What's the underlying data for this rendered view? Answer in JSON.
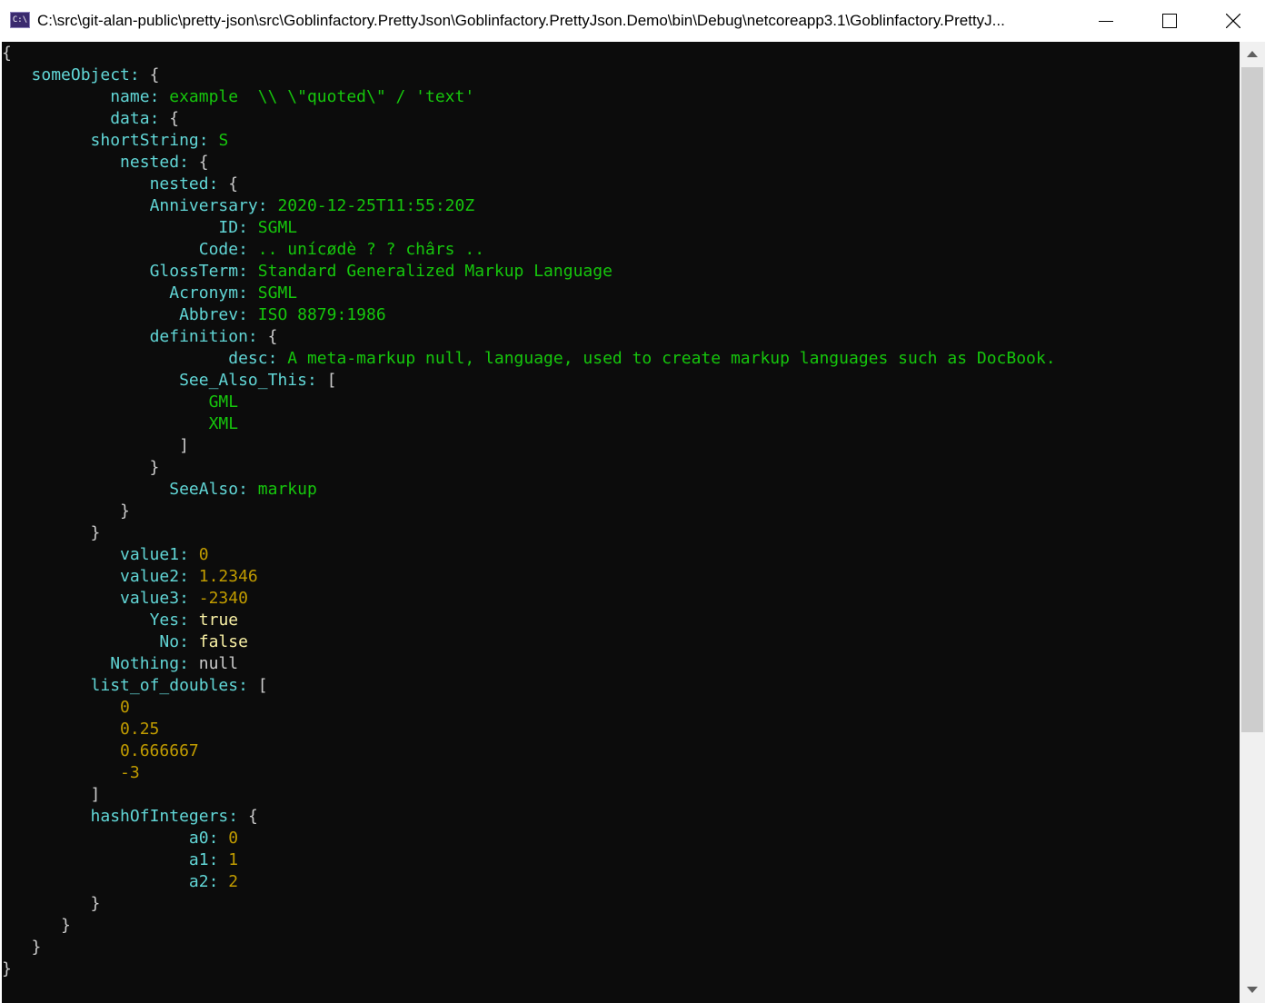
{
  "window": {
    "title": "C:\\src\\git-alan-public\\pretty-json\\src\\Goblinfactory.PrettyJson\\Goblinfactory.PrettyJson.Demo\\bin\\Debug\\netcoreapp3.1\\Goblinfactory.PrettyJ...",
    "icon_label": "C:\\"
  },
  "colors": {
    "key": "#61d6d6",
    "string": "#16c60c",
    "number": "#c19c00",
    "boolean": "#f9f1a5",
    "punctuation": "#cccccc",
    "background": "#0c0c0c"
  },
  "console": {
    "lines": [
      [
        {
          "t": "p",
          "v": "{"
        }
      ],
      [
        {
          "t": "p",
          "v": "   "
        },
        {
          "t": "k",
          "v": "someObject:"
        },
        {
          "t": "p",
          "v": " {"
        }
      ],
      [
        {
          "t": "p",
          "v": "           "
        },
        {
          "t": "k",
          "v": "name:"
        },
        {
          "t": "p",
          "v": " "
        },
        {
          "t": "s",
          "v": "example  \\\\ \\\"quoted\\\" / 'text'"
        }
      ],
      [
        {
          "t": "p",
          "v": "           "
        },
        {
          "t": "k",
          "v": "data:"
        },
        {
          "t": "p",
          "v": " {"
        }
      ],
      [
        {
          "t": "p",
          "v": "         "
        },
        {
          "t": "k",
          "v": "shortString:"
        },
        {
          "t": "p",
          "v": " "
        },
        {
          "t": "s",
          "v": "S"
        }
      ],
      [
        {
          "t": "p",
          "v": "            "
        },
        {
          "t": "k",
          "v": "nested:"
        },
        {
          "t": "p",
          "v": " {"
        }
      ],
      [
        {
          "t": "p",
          "v": "               "
        },
        {
          "t": "k",
          "v": "nested:"
        },
        {
          "t": "p",
          "v": " {"
        }
      ],
      [
        {
          "t": "p",
          "v": "               "
        },
        {
          "t": "k",
          "v": "Anniversary:"
        },
        {
          "t": "p",
          "v": " "
        },
        {
          "t": "s",
          "v": "2020-12-25T11:55:20Z"
        }
      ],
      [
        {
          "t": "p",
          "v": "                      "
        },
        {
          "t": "k",
          "v": "ID:"
        },
        {
          "t": "p",
          "v": " "
        },
        {
          "t": "s",
          "v": "SGML"
        }
      ],
      [
        {
          "t": "p",
          "v": "                    "
        },
        {
          "t": "k",
          "v": "Code:"
        },
        {
          "t": "p",
          "v": " "
        },
        {
          "t": "s",
          "v": ".. unícødè ? ? chârs .."
        }
      ],
      [
        {
          "t": "p",
          "v": "               "
        },
        {
          "t": "k",
          "v": "GlossTerm:"
        },
        {
          "t": "p",
          "v": " "
        },
        {
          "t": "s",
          "v": "Standard Generalized Markup Language"
        }
      ],
      [
        {
          "t": "p",
          "v": "                 "
        },
        {
          "t": "k",
          "v": "Acronym:"
        },
        {
          "t": "p",
          "v": " "
        },
        {
          "t": "s",
          "v": "SGML"
        }
      ],
      [
        {
          "t": "p",
          "v": "                  "
        },
        {
          "t": "k",
          "v": "Abbrev:"
        },
        {
          "t": "p",
          "v": " "
        },
        {
          "t": "s",
          "v": "ISO 8879:1986"
        }
      ],
      [
        {
          "t": "p",
          "v": "               "
        },
        {
          "t": "k",
          "v": "definition:"
        },
        {
          "t": "p",
          "v": " {"
        }
      ],
      [
        {
          "t": "p",
          "v": "                       "
        },
        {
          "t": "k",
          "v": "desc:"
        },
        {
          "t": "p",
          "v": " "
        },
        {
          "t": "s",
          "v": "A meta-markup null, language, used to create markup languages such as DocBook."
        }
      ],
      [
        {
          "t": "p",
          "v": "                  "
        },
        {
          "t": "k",
          "v": "See_Also_This:"
        },
        {
          "t": "p",
          "v": " ["
        }
      ],
      [
        {
          "t": "p",
          "v": "                     "
        },
        {
          "t": "s",
          "v": "GML"
        }
      ],
      [
        {
          "t": "p",
          "v": "                     "
        },
        {
          "t": "s",
          "v": "XML"
        }
      ],
      [
        {
          "t": "p",
          "v": "                  ]"
        }
      ],
      [
        {
          "t": "p",
          "v": "               }"
        }
      ],
      [
        {
          "t": "p",
          "v": "                 "
        },
        {
          "t": "k",
          "v": "SeeAlso:"
        },
        {
          "t": "p",
          "v": " "
        },
        {
          "t": "s",
          "v": "markup"
        }
      ],
      [
        {
          "t": "p",
          "v": "            }"
        }
      ],
      [
        {
          "t": "p",
          "v": "         }"
        }
      ],
      [
        {
          "t": "p",
          "v": "            "
        },
        {
          "t": "k",
          "v": "value1:"
        },
        {
          "t": "p",
          "v": " "
        },
        {
          "t": "n",
          "v": "0"
        }
      ],
      [
        {
          "t": "p",
          "v": "            "
        },
        {
          "t": "k",
          "v": "value2:"
        },
        {
          "t": "p",
          "v": " "
        },
        {
          "t": "n",
          "v": "1.2346"
        }
      ],
      [
        {
          "t": "p",
          "v": "            "
        },
        {
          "t": "k",
          "v": "value3:"
        },
        {
          "t": "p",
          "v": " "
        },
        {
          "t": "n",
          "v": "-2340"
        }
      ],
      [
        {
          "t": "p",
          "v": "               "
        },
        {
          "t": "k",
          "v": "Yes:"
        },
        {
          "t": "p",
          "v": " "
        },
        {
          "t": "b",
          "v": "true"
        }
      ],
      [
        {
          "t": "p",
          "v": "                "
        },
        {
          "t": "k",
          "v": "No:"
        },
        {
          "t": "p",
          "v": " "
        },
        {
          "t": "b",
          "v": "false"
        }
      ],
      [
        {
          "t": "p",
          "v": "           "
        },
        {
          "t": "k",
          "v": "Nothing:"
        },
        {
          "t": "p",
          "v": " null"
        }
      ],
      [
        {
          "t": "p",
          "v": "         "
        },
        {
          "t": "k",
          "v": "list_of_doubles:"
        },
        {
          "t": "p",
          "v": " ["
        }
      ],
      [
        {
          "t": "p",
          "v": "            "
        },
        {
          "t": "n",
          "v": "0"
        }
      ],
      [
        {
          "t": "p",
          "v": "            "
        },
        {
          "t": "n",
          "v": "0.25"
        }
      ],
      [
        {
          "t": "p",
          "v": "            "
        },
        {
          "t": "n",
          "v": "0.666667"
        }
      ],
      [
        {
          "t": "p",
          "v": "            "
        },
        {
          "t": "n",
          "v": "-3"
        }
      ],
      [
        {
          "t": "p",
          "v": "         ]"
        }
      ],
      [
        {
          "t": "p",
          "v": "         "
        },
        {
          "t": "k",
          "v": "hashOfIntegers:"
        },
        {
          "t": "p",
          "v": " {"
        }
      ],
      [
        {
          "t": "p",
          "v": "                   "
        },
        {
          "t": "k",
          "v": "a0:"
        },
        {
          "t": "p",
          "v": " "
        },
        {
          "t": "n",
          "v": "0"
        }
      ],
      [
        {
          "t": "p",
          "v": "                   "
        },
        {
          "t": "k",
          "v": "a1:"
        },
        {
          "t": "p",
          "v": " "
        },
        {
          "t": "n",
          "v": "1"
        }
      ],
      [
        {
          "t": "p",
          "v": "                   "
        },
        {
          "t": "k",
          "v": "a2:"
        },
        {
          "t": "p",
          "v": " "
        },
        {
          "t": "n",
          "v": "2"
        }
      ],
      [
        {
          "t": "p",
          "v": "         }"
        }
      ],
      [
        {
          "t": "p",
          "v": "      }"
        }
      ],
      [
        {
          "t": "p",
          "v": "   }"
        }
      ],
      [
        {
          "t": "p",
          "v": "}"
        }
      ]
    ]
  },
  "icons": {
    "app": "console-app-icon",
    "minimize": "minimize-icon",
    "maximize": "maximize-icon",
    "close": "close-icon",
    "scroll_up": "scroll-up-arrow-icon",
    "scroll_down": "scroll-down-arrow-icon"
  }
}
